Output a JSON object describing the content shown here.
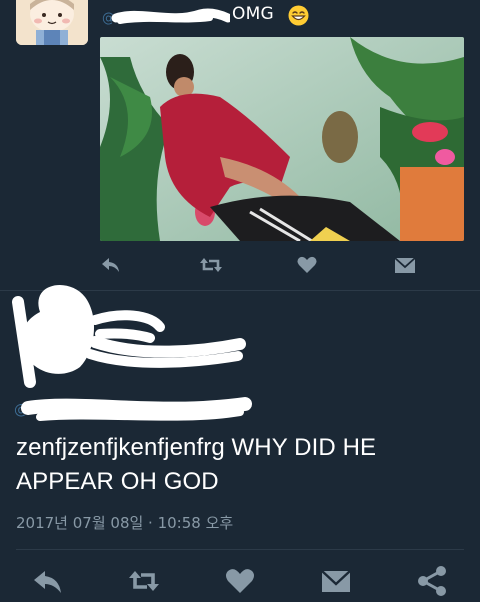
{
  "tweet1": {
    "text": "OMG",
    "emoji": "grinning-face-emoji",
    "actions": [
      {
        "name": "reply-icon"
      },
      {
        "name": "retweet-icon"
      },
      {
        "name": "like-icon"
      },
      {
        "name": "direct-message-icon"
      }
    ]
  },
  "tweet2": {
    "text_line1": "zenfjzenfjkenfjenfrg WHY DID HE",
    "text_line2": "APPEAR OH GOD",
    "timestamp": "2017년 07월 08일 · 10:58 오후",
    "actions": [
      {
        "name": "reply-icon"
      },
      {
        "name": "retweet-icon"
      },
      {
        "name": "like-icon"
      },
      {
        "name": "direct-message-icon"
      },
      {
        "name": "share-icon"
      }
    ]
  },
  "colors": {
    "background": "#1b2835",
    "icon": "#8899a6",
    "text": "#ffffff",
    "meta_text": "#8899a6",
    "divider": "#2c3a48"
  }
}
